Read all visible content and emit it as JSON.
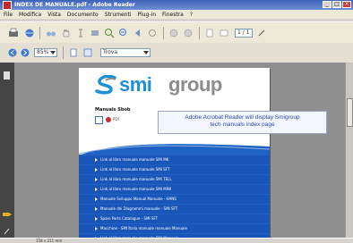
{
  "window": {
    "title": "INDEX DE MANUALE.pdf - Adobe Reader"
  },
  "menu": [
    "File",
    "Modifica",
    "Vista",
    "Documento",
    "Strumenti",
    "Plug-in",
    "Finestra",
    "?"
  ],
  "toolbar": {
    "zoom_value": "85%",
    "tools_value": "Trova",
    "page_value": "1 / 1"
  },
  "document": {
    "logo_smi": "smi",
    "logo_group": "group",
    "section_title": "Manuals Sbob",
    "icon_label": "PDF"
  },
  "tooltip": {
    "line1": "Adobe Acrobat Reader will display Smigroup",
    "line2": "tech manuals index page"
  },
  "manual_links": [
    "Link al libro manuale manuale SMI MK",
    "Link al libro manuale manuale SMI SFT",
    "Link al libro manuale manuale SMI TELL",
    "Link al libro manuale manuale SMI MINI",
    "Manuale Sviluppo Manual Manuale - HANS",
    "Manuale dei Diagrammi manuale - SMI SFT",
    "Spare Parts Catalogue - SMI SFT",
    "Macchine - SMI Italia manuale manuale Manuale",
    "Link al libro manuale manuale SMI Manuale"
  ],
  "status": {
    "text": "158 x 211 mm"
  },
  "colors": {
    "titlebar": "#3d62b7",
    "link_bar": "#1a56b8",
    "tooltip_text": "#2b4aa8",
    "logo_blue": "#1d8fd4",
    "logo_gray": "#8a8c8e"
  }
}
